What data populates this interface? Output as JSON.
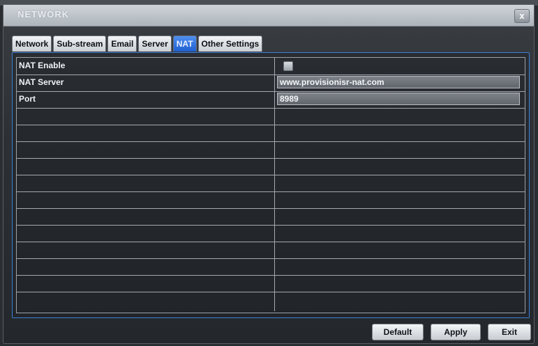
{
  "window": {
    "title": "NETWORK",
    "close_label": "x"
  },
  "tabs": [
    {
      "label": "Network",
      "active": false
    },
    {
      "label": "Sub-stream",
      "active": false
    },
    {
      "label": "Email",
      "active": false
    },
    {
      "label": "Server",
      "active": false
    },
    {
      "label": "NAT",
      "active": true
    },
    {
      "label": "Other Settings",
      "active": false
    }
  ],
  "settings": {
    "nat_enable": {
      "label": "NAT Enable",
      "checked": false
    },
    "nat_server": {
      "label": "NAT Server",
      "value": "www.provisionisr-nat.com"
    },
    "port": {
      "label": "Port",
      "value": "8989"
    }
  },
  "buttons": {
    "default_label": "Default",
    "apply_label": "Apply",
    "exit_label": "Exit"
  },
  "colors": {
    "accent": "#3e7fd6",
    "active_tab": "#2f6fe0",
    "background": "#2a2e33"
  }
}
